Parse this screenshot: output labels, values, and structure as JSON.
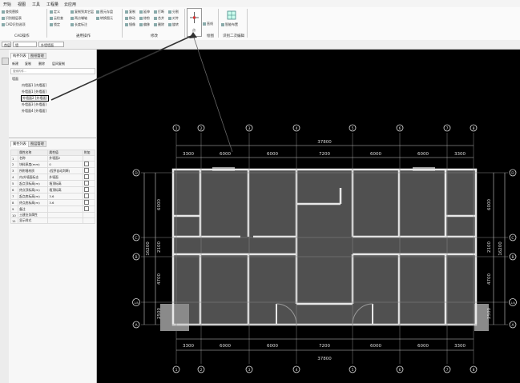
{
  "menu": {
    "items": [
      "开始",
      "视图",
      "工具",
      "工程量",
      "云应用"
    ]
  },
  "ribbon": {
    "group_labels": {
      "cad": "CAD操作",
      "common": "通用操作",
      "modify": "修改",
      "draw": "绘图",
      "smart": "识别二次编辑"
    },
    "cad_buttons": [
      "查找替换",
      "识别楼层表",
      "CAD识别选项"
    ],
    "common_buttons": [
      "定义",
      "云检查",
      "锁定",
      "复制到其它层",
      "两点辅轴",
      "长度标注",
      "图元存盘",
      "转换图元"
    ],
    "modify_buttons": [
      "复制",
      "移动",
      "镜像",
      "延伸",
      "修剪",
      "偏移",
      "打断",
      "合并",
      "删除",
      "分割",
      "对齐",
      "旋转"
    ],
    "draw_buttons": [
      "点",
      "直线"
    ],
    "smart_button": "智能布置"
  },
  "selectors": {
    "floor": "首层",
    "type": "墙",
    "subtype": "外墙墙面"
  },
  "nav": {
    "tabs": [
      "构件列表",
      "图纸管理"
    ],
    "toolbar": [
      "新建",
      "复制",
      "删除",
      "层间复制"
    ],
    "search_placeholder": "搜索构件...",
    "tree_root": "墙面",
    "tree_items": [
      "内墙面1 [内墙面]",
      "外墙面1 [外墙面]",
      "外墙面2 [外墙面]",
      "外墙面3 [外墙面]",
      "外墙面4 [外墙面]"
    ],
    "selected_index": 2
  },
  "props": {
    "tabs": [
      "属性列表",
      "图层管理"
    ],
    "headers": [
      "属性名称",
      "属性值",
      "附加"
    ],
    "rows": [
      {
        "n": "1",
        "name": "名称",
        "value": "外墙面2"
      },
      {
        "n": "2",
        "name": "块料厚度(mm)",
        "value": "0"
      },
      {
        "n": "3",
        "name": "所附墙材质",
        "value": "(程序自动判断)"
      },
      {
        "n": "4",
        "name": "内/外墙面标志",
        "value": "外墙面"
      },
      {
        "n": "5",
        "name": "起点顶标高(m)",
        "value": "墙顶标高"
      },
      {
        "n": "6",
        "name": "终点顶标高(m)",
        "value": "墙顶标高"
      },
      {
        "n": "7",
        "name": "起点底标高(m)",
        "value": "3.6"
      },
      {
        "n": "8",
        "name": "终点底标高(m)",
        "value": "3.6"
      },
      {
        "n": "9",
        "name": "备注",
        "value": ""
      },
      {
        "n": "10",
        "name": "土建业务属性",
        "value": ""
      },
      {
        "n": "11",
        "name": "显示样式",
        "value": ""
      }
    ]
  },
  "drawing": {
    "grid_top": [
      "1",
      "2",
      "3",
      "4",
      "5",
      "6",
      "7",
      "8"
    ],
    "top_total": "37800",
    "top_spans": [
      "3300",
      "6000",
      "6000",
      "7200",
      "6000",
      "6000",
      "3300"
    ],
    "bottom_spans": [
      "3300",
      "6000",
      "6000",
      "7200",
      "6000",
      "6000",
      "3300"
    ],
    "bottom_total": "37800",
    "grid_side": [
      "D",
      "C",
      "B",
      "1/A",
      "A"
    ],
    "left_spans": [
      "6000",
      "2100",
      "4700",
      "2500"
    ],
    "left_total": "16200",
    "right_spans": [
      "6000",
      "2100",
      "4700",
      "2500"
    ],
    "right_total": "16200"
  }
}
